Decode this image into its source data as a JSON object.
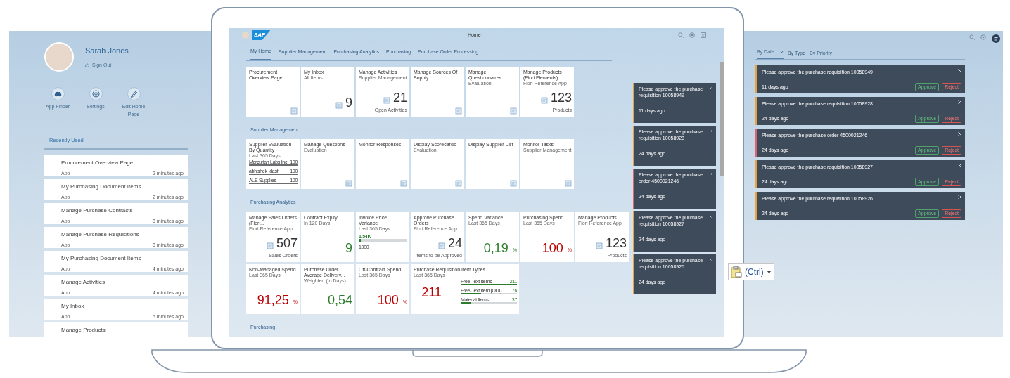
{
  "profile": {
    "name": "Sarah Jones",
    "sign_out": "Sign Out"
  },
  "actions": [
    {
      "label": "App Finder"
    },
    {
      "label": "Settings"
    },
    {
      "label": "Edit Home Page"
    }
  ],
  "recently_used": {
    "title": "Recently Used",
    "items": [
      {
        "title": "Procurement Overview Page",
        "type": "App",
        "time": "2 minutes ago"
      },
      {
        "title": "My Purchasing Document Items",
        "type": "App",
        "time": "2 minutes ago"
      },
      {
        "title": "Manage Purchase Contracts",
        "type": "App",
        "time": "3 minutes ago"
      },
      {
        "title": "Manage Purchase Requisitions",
        "type": "App",
        "time": "3 minutes ago"
      },
      {
        "title": "My Purchasing Document Items",
        "type": "App",
        "time": "4 minutes ago"
      },
      {
        "title": "Manage Activities",
        "type": "App",
        "time": "4 minutes ago"
      },
      {
        "title": "My Inbox",
        "type": "App",
        "time": "5 minutes ago"
      },
      {
        "title": "Manage Products"
      }
    ]
  },
  "shell": {
    "logo": "SAP",
    "title": "Home"
  },
  "tabs": [
    {
      "label": "My Home",
      "selected": true
    },
    {
      "label": "Supplier Management",
      "selected": false
    },
    {
      "label": "Purchasing Analytics",
      "selected": false
    },
    {
      "label": "Purchasing",
      "selected": false
    },
    {
      "label": "Purchase Order Processing",
      "selected": false
    }
  ],
  "groups": [
    {
      "tiles": [
        {
          "kind": "launch",
          "title": "Procurement Overview Page"
        },
        {
          "kind": "icon_number",
          "title": "My Inbox",
          "subtitle": "All Items",
          "number": "9",
          "color": "#333333"
        },
        {
          "kind": "icon_number",
          "title": "Manage Activities",
          "subtitle": "Supplier Management",
          "number": "21",
          "footer": "Open Activities",
          "color": "#333333"
        },
        {
          "kind": "launch",
          "title": "Manage Sources Of Supply"
        },
        {
          "kind": "launch",
          "title": "Manage Questionnaires",
          "subtitle": "Evaluation"
        },
        {
          "kind": "icon_number",
          "title": "Manage Products (Fiori Elements)",
          "subtitle": "Fiori Reference App",
          "number": "123",
          "footer": "Products",
          "color": "#333333"
        }
      ]
    },
    {
      "title": "Supplier Management",
      "tiles": [
        {
          "kind": "comparison",
          "title": "Supplier Evaluation By Quantity",
          "subtitle": "Last 365 Days",
          "rows": [
            {
              "label": "Mercurian Labs Inc",
              "value": "100",
              "level": 1
            },
            {
              "label": "abhishek_dash",
              "value": "100",
              "level": 1
            },
            {
              "label": "ALE Supplies",
              "value": "100",
              "level": 1
            }
          ]
        },
        {
          "kind": "launch",
          "title": "Manage Questions",
          "subtitle": "Evaluation"
        },
        {
          "kind": "launch",
          "title": "Monitor Responses"
        },
        {
          "kind": "launch",
          "title": "Display Scorecards",
          "subtitle": "Evaluation"
        },
        {
          "kind": "launch",
          "title": "Display Supplier List"
        },
        {
          "kind": "launch",
          "title": "Monitor Tasks",
          "subtitle": "Supplier Management"
        }
      ]
    },
    {
      "title": "Purchasing Analytics",
      "tiles": [
        {
          "kind": "icon_number",
          "title": "Manage Sales Orders (Fiori...",
          "subtitle": "Fiori Reference App",
          "number": "507",
          "footer": "Sales Orders",
          "color": "#333333"
        },
        {
          "kind": "number",
          "title": "Contract Expiry",
          "subtitle": "In 120 Days",
          "number": "9",
          "color": "#2b7d2b"
        },
        {
          "kind": "bullet",
          "title": "Invoice Price Variance",
          "subtitle": "Last 365 Days",
          "value_label": "1,54K",
          "level": 0.04,
          "base_label": "1000"
        },
        {
          "kind": "icon_number",
          "title": "Approve Purchase Orders",
          "subtitle": "Fiori Reference App",
          "number": "24",
          "footer": "Items to be Approved",
          "color": "#333333"
        },
        {
          "kind": "number",
          "title": "Spend Variance",
          "subtitle": "Last 365 Days",
          "number": "0,19",
          "unit": "%",
          "color": "#2b7d2b"
        },
        {
          "kind": "number",
          "title": "Purchasing Spend",
          "subtitle": "Last 365 Days",
          "number": "100",
          "unit": "%",
          "color": "#bb0000"
        },
        {
          "kind": "icon_number",
          "title": "Manage Products",
          "subtitle": "Fiori Reference App",
          "number": "123",
          "footer": "Products",
          "color": "#333333"
        },
        {
          "kind": "number",
          "title": "Non-Managed Spend",
          "subtitle": "Last 365 Days",
          "number": "91,25",
          "unit": "%",
          "color": "#bb0000"
        },
        {
          "kind": "number",
          "title": "Purchase Order Average Delivery...",
          "subtitle": "Weighted (In Days)",
          "number": "0,54",
          "color": "#2b7d2b"
        },
        {
          "kind": "number",
          "title": "Off-Contract Spend",
          "subtitle": "Last 365 Days",
          "number": "100",
          "unit": "%",
          "color": "#bb0000"
        },
        {
          "kind": "number_comparison",
          "title": "Purchase Requisition Item Types",
          "subtitle": "Last 365 Days",
          "wide": true,
          "number": "211",
          "color": "#bb0000",
          "rows": [
            {
              "label": "Free-Text Items",
              "value": "211",
              "level": 1
            },
            {
              "label": "Free-Text Item (OUI)",
              "value": "76",
              "level": 0.36
            },
            {
              "label": "Material Items",
              "value": "37",
              "level": 0.18
            }
          ]
        }
      ]
    },
    {
      "title": "Purchasing"
    }
  ],
  "notifications": [
    {
      "text": "Please approve the purchase requisition 10058949",
      "time": "11 days ago",
      "color": "#e9a13b"
    },
    {
      "text": "Please approve the purchase requisition 10058928",
      "time": "24 days ago",
      "color": "#e9a13b"
    },
    {
      "text": "Please approve the purchase order 4500021246",
      "time": "24 days ago",
      "color": "#e0606e"
    },
    {
      "text": "Please approve the purchase requisition 10058927",
      "time": "24 days ago",
      "color": "#e9a13b"
    },
    {
      "text": "Please approve the purchase requisition 10058926",
      "time": "24 days ago",
      "color": "#e9a13b"
    }
  ],
  "paste_options": {
    "label": "(Ctrl)"
  },
  "notification_panel": {
    "tabs": [
      {
        "label": "By Date",
        "selected": true
      },
      {
        "label": "By Type",
        "selected": false
      },
      {
        "label": "By Priority",
        "selected": false
      }
    ],
    "items": [
      {
        "text": "Please approve the purchase requisition 10058949",
        "time": "11 days ago",
        "color": "#e9a13b",
        "approve": "Approve",
        "reject": "Reject"
      },
      {
        "text": "Please approve the purchase requisition 10058928",
        "time": "24 days ago",
        "color": "#e9a13b",
        "approve": "Approve",
        "reject": "Reject"
      },
      {
        "text": "Please approve the purchase order 4500021246",
        "time": "24 days ago",
        "color": "#e0606e",
        "approve": "Approve",
        "reject": "Reject"
      },
      {
        "text": "Please approve the purchase requisition 10058927",
        "time": "24 days ago",
        "color": "#e9a13b",
        "approve": "Approve",
        "reject": "Reject"
      },
      {
        "text": "Please approve the purchase requisition 10058926",
        "time": "24 days ago",
        "color": "#e9a13b",
        "approve": "Approve",
        "reject": "Reject"
      }
    ]
  }
}
